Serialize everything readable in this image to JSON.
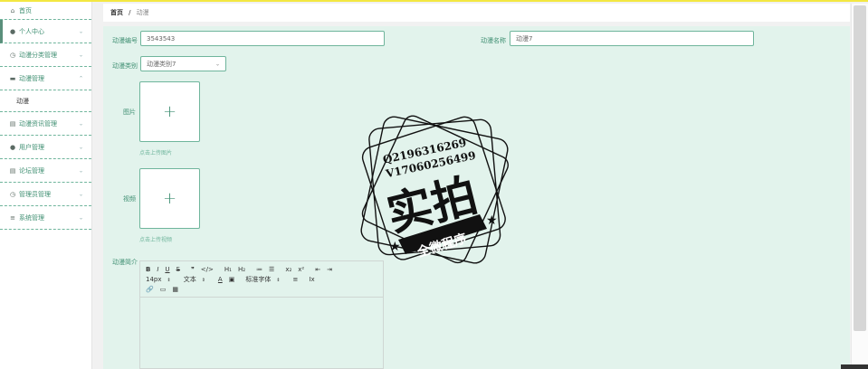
{
  "sidebar": {
    "items": [
      {
        "label": "首页",
        "icon": "home-icon",
        "glyph": "⌂"
      },
      {
        "label": "个人中心",
        "icon": "user-icon",
        "glyph": "●"
      },
      {
        "label": "动漫分类管理",
        "icon": "clock-icon",
        "glyph": "◷"
      },
      {
        "label": "动漫管理",
        "icon": "monitor-icon",
        "glyph": "▬"
      },
      {
        "label": "动漫资讯管理",
        "icon": "document-icon",
        "glyph": "▤"
      },
      {
        "label": "用户管理",
        "icon": "user-icon",
        "glyph": "●"
      },
      {
        "label": "论坛管理",
        "icon": "document-icon",
        "glyph": "▤"
      },
      {
        "label": "管理员管理",
        "icon": "clock-icon",
        "glyph": "◷"
      },
      {
        "label": "系统管理",
        "icon": "list-icon",
        "glyph": "≡"
      }
    ],
    "submenu_label": "动漫"
  },
  "header": {
    "home": "首页",
    "sep": "/",
    "current": "动漫"
  },
  "form": {
    "id_label": "动漫编号",
    "id_value": "3543543",
    "name_label": "动漫名称",
    "name_value": "动漫7",
    "category_label": "动漫类别",
    "category_value": "动漫类别7",
    "image_label": "图片",
    "image_tip": "点击上传图片",
    "video_label": "视频",
    "video_tip": "点击上传视频",
    "intro_label": "动漫简介"
  },
  "editor": {
    "row1": [
      "B",
      "I",
      "U",
      "S",
      "❞",
      "</>",
      "H₁",
      "H₂",
      "≔",
      "☰",
      "x₂",
      "x²",
      "⇤",
      "⇥"
    ],
    "row2": {
      "size": "14px",
      "type": "文本",
      "font": "标准字体",
      "icons": [
        "A",
        "▣",
        "≡",
        "Ix"
      ]
    },
    "row3": [
      "🔗",
      "▭",
      "▦"
    ]
  },
  "stamp": {
    "line1": "Q2196316269",
    "line2": "V17060256499",
    "big": "实拍",
    "ribbon": "全微程序"
  },
  "colors": {
    "accent": "#3f8f72",
    "border": "#6fb59c",
    "bg": "#e2f3ec"
  }
}
